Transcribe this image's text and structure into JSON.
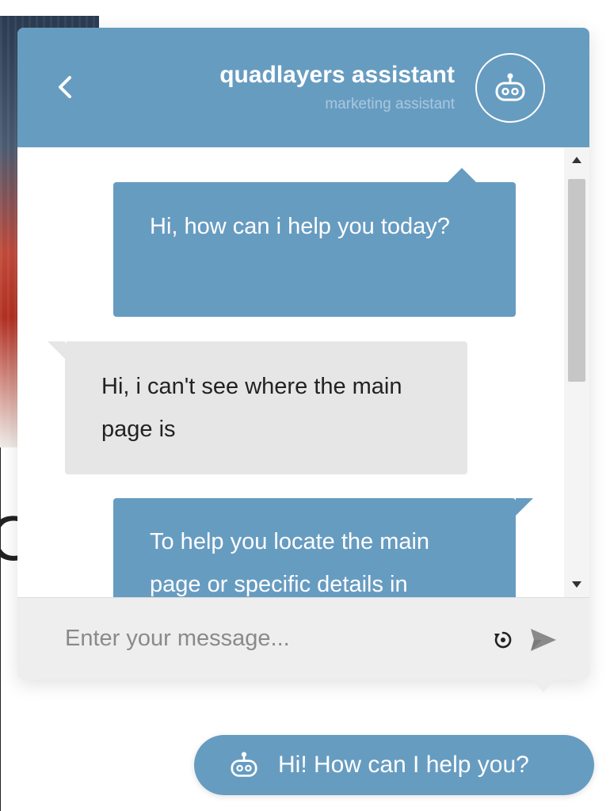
{
  "colors": {
    "accent": "#679cc1",
    "user_bubble": "#e6e6e6",
    "input_bg": "#eeeeee",
    "subtitle": "#a9c8de"
  },
  "header": {
    "title": "quadlayers assistant",
    "subtitle": "marketing assistant",
    "back_icon": "chevron-left-icon",
    "avatar_icon": "robot-icon"
  },
  "messages": [
    {
      "role": "assistant",
      "text": "Hi, how can i help you today?"
    },
    {
      "role": "user",
      "text": "Hi, i can't see where the main page is"
    },
    {
      "role": "assistant",
      "text": "To help you locate the main page or specific details in"
    }
  ],
  "input": {
    "placeholder": "Enter your message...",
    "value": "",
    "reset_icon": "reset-icon",
    "send_icon": "send-icon"
  },
  "launcher": {
    "label": "Hi! How can I help you?",
    "icon": "robot-icon"
  }
}
